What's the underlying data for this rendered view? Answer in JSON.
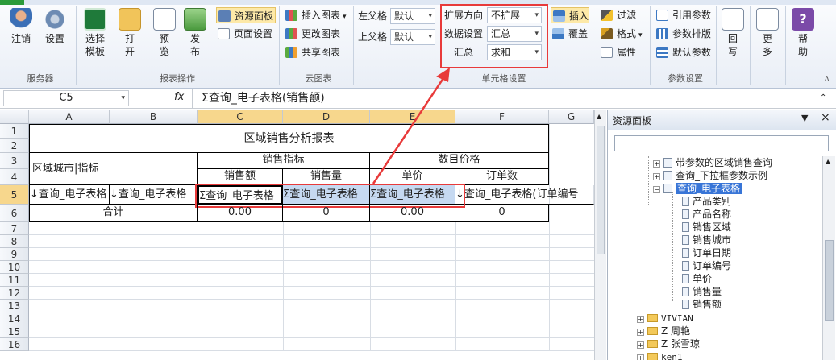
{
  "ribbon": {
    "groups": [
      {
        "label": "服务器",
        "buttons": [
          "注销",
          "设置"
        ]
      },
      {
        "label": "报表操作",
        "buttons": [
          "选择\n模板",
          "打\n开",
          "预\n览",
          "发\n布"
        ],
        "small": [
          "资源面板",
          "页面设置"
        ]
      },
      {
        "label": "云图表",
        "small": [
          "插入图表",
          "更改图表",
          "共享图表"
        ]
      },
      {
        "label": "单元格设置",
        "fields": {
          "left_parent": {
            "label": "左父格",
            "value": "默认"
          },
          "top_parent": {
            "label": "上父格",
            "value": "默认"
          },
          "expand_dir": {
            "label": "扩展方向",
            "value": "不扩展"
          },
          "data_setting": {
            "label": "数据设置",
            "value": "汇总"
          },
          "summary": {
            "label": "汇总",
            "value": "求和"
          }
        },
        "small": [
          "插入",
          "覆盖",
          "过滤",
          "格式",
          "属性"
        ]
      },
      {
        "label": "参数设置",
        "small": [
          "引用参数",
          "参数排版",
          "默认参数"
        ]
      },
      {
        "label": "",
        "buttons": [
          "回\n写",
          "更\n多",
          "帮\n助"
        ]
      }
    ],
    "dropdown_arrow": "▾"
  },
  "formula_bar": {
    "cell_ref": "C5",
    "fx": "fx",
    "formula": "Σ查询_电子表格(销售额)"
  },
  "grid": {
    "columns": [
      "A",
      "B",
      "C",
      "D",
      "E",
      "F",
      "G"
    ],
    "rows": [
      "1",
      "2",
      "3",
      "4",
      "5",
      "6",
      "7",
      "8",
      "9",
      "10",
      "11",
      "12",
      "13",
      "14",
      "15",
      "16"
    ],
    "title": "区域销售分析报表",
    "header_region": "区域城市|指标",
    "sales_metric": "销售指标",
    "sales_amount": "销售额",
    "sales_qty": "销售量",
    "count_price": "数目价格",
    "unit_price": "单价",
    "order_count": "订单数",
    "row5": [
      "↓查询_电子表格",
      "↓查询_电子表格",
      "Σ查询_电子表格",
      "Σ查询_电子表格",
      "Σ查询_电子表格",
      "↓查询_电子表格(订单编号"
    ],
    "total_label": "合计",
    "row6": [
      "0.00",
      "0",
      "0.00",
      "0"
    ]
  },
  "panel": {
    "title": "资源面板",
    "search_placeholder": "",
    "tree": [
      {
        "label": "带参数的区域销售查询",
        "type": "table",
        "level": 1
      },
      {
        "label": "查询_下拉框参数示例",
        "type": "table",
        "level": 1
      },
      {
        "label": "查询_电子表格",
        "type": "table",
        "level": 1,
        "selected": true
      },
      {
        "label": "产品类别",
        "type": "field",
        "level": 2
      },
      {
        "label": "产品名称",
        "type": "field",
        "level": 2
      },
      {
        "label": "销售区域",
        "type": "field",
        "level": 2
      },
      {
        "label": "销售城市",
        "type": "field",
        "level": 2
      },
      {
        "label": "订单日期",
        "type": "field",
        "level": 2
      },
      {
        "label": "订单编号",
        "type": "field",
        "level": 2
      },
      {
        "label": "单价",
        "type": "field",
        "level": 2
      },
      {
        "label": "销售量",
        "type": "field",
        "level": 2
      },
      {
        "label": "销售额",
        "type": "field",
        "level": 2
      },
      {
        "label": "VIVIAN",
        "type": "folder",
        "level": 0
      },
      {
        "label": "Z 周艳",
        "type": "folder",
        "level": 0
      },
      {
        "label": "Z 张雪琼",
        "type": "folder",
        "level": 0
      },
      {
        "label": "ken1",
        "type": "folder",
        "level": 0
      }
    ]
  },
  "colors": {
    "highlight_red": "#e83a3a",
    "ribbon_bg": "#e9eef6",
    "selected_cell": "#c6d9f1"
  }
}
